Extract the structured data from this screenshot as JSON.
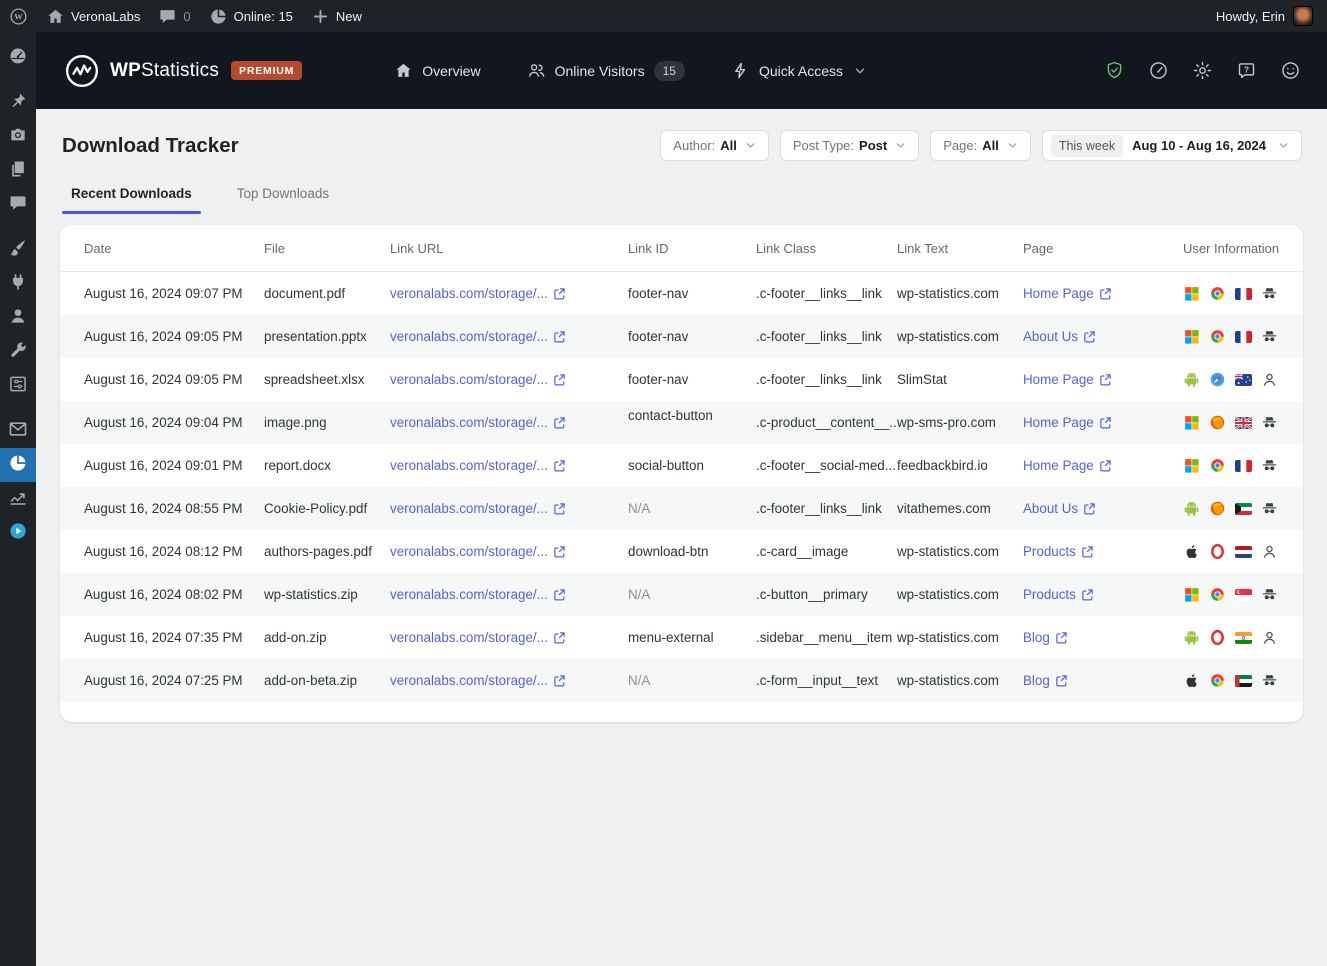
{
  "colors": {
    "admin_bar_bg": "#1d2327",
    "plugin_header_bg": "#12161f",
    "active_menu_blue": "#2271b1",
    "premium_badge": "#b54a2f",
    "link": "#5661e1",
    "tab_underline": "#4754e6",
    "shield_green": "#6cc070",
    "content_bg": "#f0f0f1",
    "play_blue": "#2ea5d8"
  },
  "admin_bar": {
    "site_name": "VeronaLabs",
    "comments_count": "0",
    "online_label": "Online: 15",
    "new_label": "New",
    "howdy": "Howdy, Erin"
  },
  "plugin_header": {
    "brand_bold": "WP",
    "brand_light": "Statistics",
    "premium_badge": "PREMIUM",
    "nav": [
      {
        "id": "overview",
        "icon": "home",
        "label": "Overview"
      },
      {
        "id": "online-visitors",
        "icon": "people",
        "label": "Online Visitors",
        "badge": "15"
      },
      {
        "id": "quick-access",
        "icon": "lightning",
        "label": "Quick Access",
        "chevron": true
      }
    ],
    "utility_icons": [
      "shield-check",
      "gauge",
      "gear",
      "help",
      "smiley"
    ]
  },
  "sidebar": {
    "items": [
      {
        "icon": "dashboard"
      },
      {
        "icon": "posts-pin",
        "gap_before": true
      },
      {
        "icon": "media"
      },
      {
        "icon": "pages"
      },
      {
        "icon": "comments"
      },
      {
        "icon": "appearance",
        "gap_before": true
      },
      {
        "icon": "plugins"
      },
      {
        "icon": "users"
      },
      {
        "icon": "tools"
      },
      {
        "icon": "settings"
      },
      {
        "icon": "mail",
        "gap_before": true
      },
      {
        "icon": "wp-statistics",
        "active": true
      },
      {
        "icon": "analytics"
      },
      {
        "icon": "video"
      }
    ]
  },
  "page": {
    "title": "Download Tracker",
    "filters": [
      {
        "id": "author",
        "label": "Author:",
        "value": "All"
      },
      {
        "id": "post-type",
        "label": "Post Type:",
        "value": "Post"
      },
      {
        "id": "page",
        "label": "Page:",
        "value": "All"
      }
    ],
    "date_filter": {
      "chip": "This week",
      "range": "Aug 10 - Aug 16, 2024"
    },
    "tabs": [
      {
        "id": "recent-downloads",
        "label": "Recent Downloads",
        "active": true
      },
      {
        "id": "top-downloads",
        "label": "Top Downloads",
        "active": false
      }
    ]
  },
  "table": {
    "columns": [
      "Date",
      "File",
      "Link URL",
      "Link ID",
      "Link Class",
      "Link Text",
      "Page",
      "User Information"
    ],
    "rows": [
      {
        "date": "August 16, 2024 09:07 PM",
        "file": "document.pdf",
        "link_url": "veronalabs.com/storage/...",
        "link_id": "footer-nav",
        "link_class": ".c-footer__links__link",
        "link_text": "wp-statistics.com",
        "page": "Home Page",
        "os": "windows",
        "browser": "chrome",
        "country": "france",
        "user_type": "incognito"
      },
      {
        "date": "August 16, 2024 09:05 PM",
        "file": "presentation.pptx",
        "link_url": "veronalabs.com/storage/...",
        "link_id": "footer-nav",
        "link_class": ".c-footer__links__link",
        "link_text": "wp-statistics.com",
        "page": "About Us",
        "os": "windows",
        "browser": "chrome",
        "country": "france",
        "user_type": "incognito"
      },
      {
        "date": "August 16, 2024 09:05 PM",
        "file": "spreadsheet.xlsx",
        "link_url": "veronalabs.com/storage/...",
        "link_id": "footer-nav",
        "link_class": ".c-footer__links__link",
        "link_text": "SlimStat",
        "page": "Home Page",
        "os": "android",
        "browser": "safari",
        "country": "australia",
        "user_type": "user"
      },
      {
        "date": "August 16, 2024 09:04 PM",
        "file": "image.png",
        "link_url": "veronalabs.com/storage/...",
        "link_id": "contact-button",
        "link_class": ".c-product__content__...",
        "link_text": "wp-sms-pro.com",
        "page": "Home Page",
        "os": "windows",
        "browser": "firefox",
        "country": "uk",
        "user_type": "incognito",
        "raised_id": true
      },
      {
        "date": "August 16, 2024 09:01 PM",
        "file": "report.docx",
        "link_url": "veronalabs.com/storage/...",
        "link_id": "social-button",
        "link_class": ".c-footer__social-med...",
        "link_text": "feedbackbird.io",
        "page": "Home Page",
        "os": "windows",
        "browser": "chrome",
        "country": "france",
        "user_type": "incognito"
      },
      {
        "date": "August 16, 2024 08:55 PM",
        "file": "Cookie-Policy.pdf",
        "link_url": "veronalabs.com/storage/...",
        "link_id": "N/A",
        "link_class": ".c-footer__links__link",
        "link_text": "vitathemes.com",
        "page": "About Us",
        "os": "android",
        "browser": "firefox",
        "country": "kuwait",
        "user_type": "incognito"
      },
      {
        "date": "August 16, 2024 08:12 PM",
        "file": "authors-pages.pdf",
        "link_url": "veronalabs.com/storage/...",
        "link_id": "download-btn",
        "link_class": ".c-card__image",
        "link_text": "wp-statistics.com",
        "page": "Products",
        "os": "apple",
        "browser": "opera",
        "country": "netherlands",
        "user_type": "user"
      },
      {
        "date": "August 16, 2024 08:02 PM",
        "file": "wp-statistics.zip",
        "link_url": "veronalabs.com/storage/...",
        "link_id": "N/A",
        "link_class": ".c-button__primary",
        "link_text": "wp-statistics.com",
        "page": "Products",
        "os": "windows",
        "browser": "chrome",
        "country": "singapore",
        "user_type": "incognito"
      },
      {
        "date": "August 16, 2024 07:35 PM",
        "file": "add-on.zip",
        "link_url": "veronalabs.com/storage/...",
        "link_id": "menu-external",
        "link_class": ".sidebar__menu__item",
        "link_text": "wp-statistics.com",
        "page": "Blog",
        "os": "android",
        "browser": "opera",
        "country": "india",
        "user_type": "user"
      },
      {
        "date": "August 16, 2024 07:25 PM",
        "file": "add-on-beta.zip",
        "link_url": "veronalabs.com/storage/...",
        "link_id": "N/A",
        "link_class": ".c-form__input__text",
        "link_text": "wp-statistics.com",
        "page": "Blog",
        "os": "apple",
        "browser": "chrome",
        "country": "uae",
        "user_type": "incognito"
      }
    ]
  }
}
